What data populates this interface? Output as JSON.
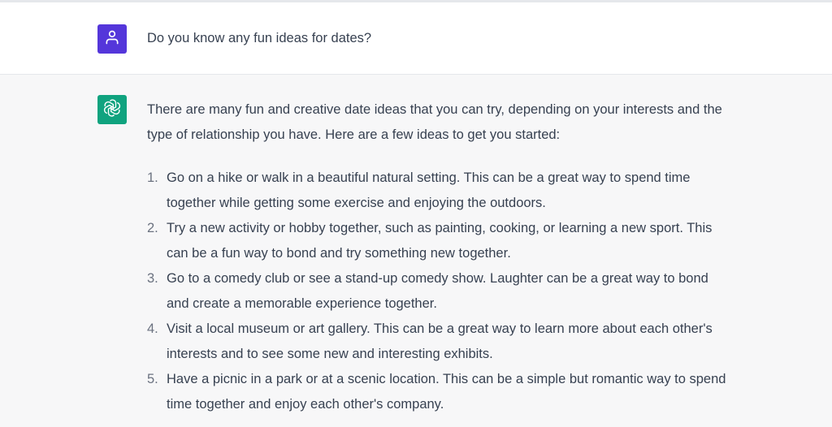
{
  "user": {
    "message": "Do you know any fun ideas for dates?",
    "avatar_icon": "user-icon",
    "avatar_color": "#5436da"
  },
  "assistant": {
    "avatar_icon": "openai-logo-icon",
    "avatar_color": "#10a37f",
    "intro": "There are many fun and creative date ideas that you can try, depending on your interests and the type of relationship you have. Here are a few ideas to get you started:",
    "ideas": [
      {
        "num": "1.",
        "text": "Go on a hike or walk in a beautiful natural setting. This can be a great way to spend time together while getting some exercise and enjoying the outdoors."
      },
      {
        "num": "2.",
        "text": "Try a new activity or hobby together, such as painting, cooking, or learning a new sport. This can be a fun way to bond and try something new together."
      },
      {
        "num": "3.",
        "text": "Go to a comedy club or see a stand-up comedy show. Laughter can be a great way to bond and create a memorable experience together."
      },
      {
        "num": "4.",
        "text": "Visit a local museum or art gallery. This can be a great way to learn more about each other's interests and to see some new and interesting exhibits."
      },
      {
        "num": "5.",
        "text": "Have a picnic in a park or at a scenic location. This can be a simple but romantic way to spend time together and enjoy each other's company."
      }
    ]
  },
  "colors": {
    "text": "#374151",
    "assistant_bg": "#f7f7f8",
    "border": "#e5e7eb"
  }
}
